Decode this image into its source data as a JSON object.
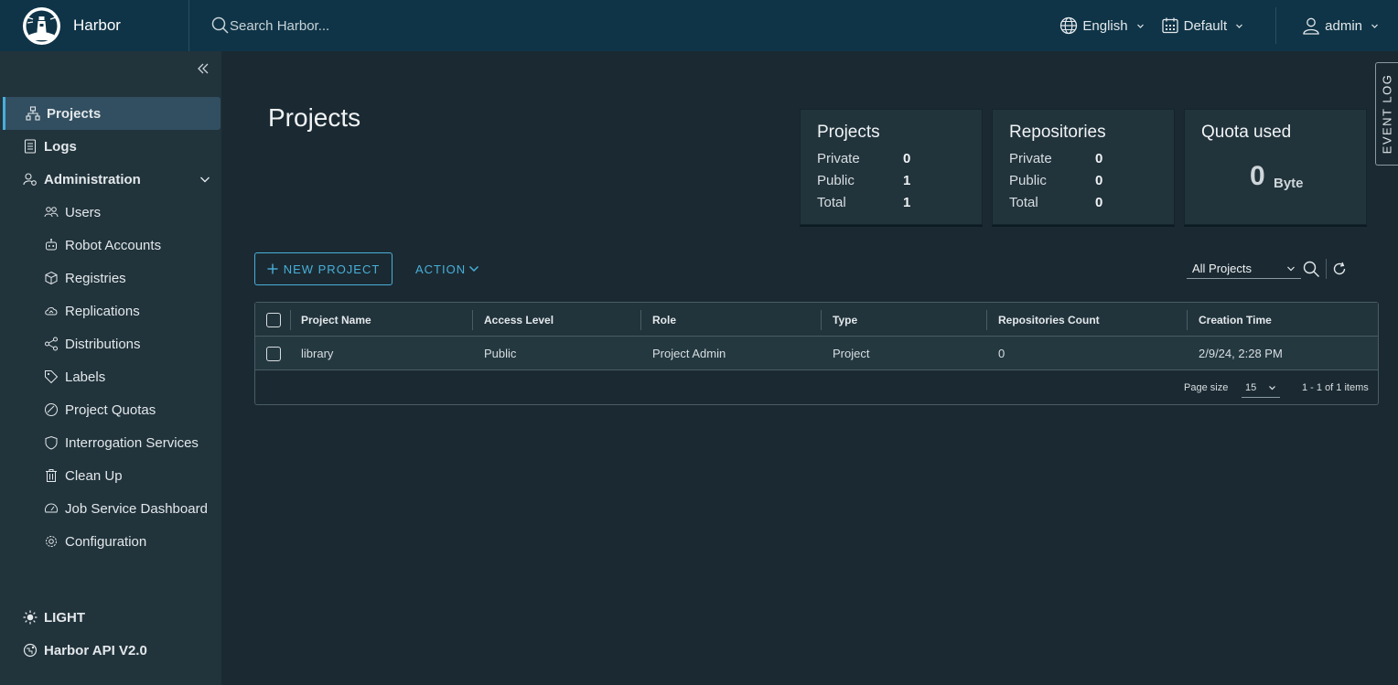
{
  "header": {
    "app_name": "Harbor",
    "search_placeholder": "Search Harbor...",
    "language": "English",
    "datetime_format": "Default",
    "user": "admin"
  },
  "sidebar": {
    "items": [
      {
        "label": "Projects",
        "icon": "org-chart-icon",
        "active": true
      },
      {
        "label": "Logs",
        "icon": "log-icon"
      },
      {
        "label": "Administration",
        "icon": "admin-icon",
        "expanded": true
      }
    ],
    "admin_items": [
      {
        "label": "Users",
        "icon": "users-icon"
      },
      {
        "label": "Robot Accounts",
        "icon": "robot-icon"
      },
      {
        "label": "Registries",
        "icon": "box-icon"
      },
      {
        "label": "Replications",
        "icon": "cloud-sync-icon"
      },
      {
        "label": "Distributions",
        "icon": "share-icon"
      },
      {
        "label": "Labels",
        "icon": "tag-icon"
      },
      {
        "label": "Project Quotas",
        "icon": "dashboard-icon"
      },
      {
        "label": "Interrogation Services",
        "icon": "shield-icon"
      },
      {
        "label": "Clean Up",
        "icon": "trash-icon"
      },
      {
        "label": "Job Service Dashboard",
        "icon": "gauge-icon"
      },
      {
        "label": "Configuration",
        "icon": "gear-icon"
      }
    ],
    "theme_toggle": "LIGHT",
    "api_link": "Harbor API V2.0"
  },
  "main": {
    "title": "Projects",
    "cards": {
      "projects": {
        "title": "Projects",
        "rows": [
          {
            "label": "Private",
            "value": "0"
          },
          {
            "label": "Public",
            "value": "1"
          },
          {
            "label": "Total",
            "value": "1"
          }
        ]
      },
      "repositories": {
        "title": "Repositories",
        "rows": [
          {
            "label": "Private",
            "value": "0"
          },
          {
            "label": "Public",
            "value": "0"
          },
          {
            "label": "Total",
            "value": "0"
          }
        ]
      },
      "quota": {
        "title": "Quota used",
        "value": "0",
        "unit": "Byte"
      }
    },
    "new_project_label": "NEW PROJECT",
    "action_label": "ACTION",
    "filter_selected": "All Projects",
    "table": {
      "columns": [
        "Project Name",
        "Access Level",
        "Role",
        "Type",
        "Repositories Count",
        "Creation Time"
      ],
      "rows": [
        {
          "name": "library",
          "access": "Public",
          "role": "Project Admin",
          "type": "Project",
          "repo_count": "0",
          "created": "2/9/24, 2:28 PM"
        }
      ],
      "page_size_label": "Page size",
      "page_size": "15",
      "items_summary": "1 - 1 of 1 items"
    },
    "event_log_label": "EVENT LOG"
  },
  "colors": {
    "header_bg": "#0f3447",
    "sidebar_bg": "#21333b",
    "content_bg": "#1b2a32",
    "accent": "#49afd9"
  }
}
